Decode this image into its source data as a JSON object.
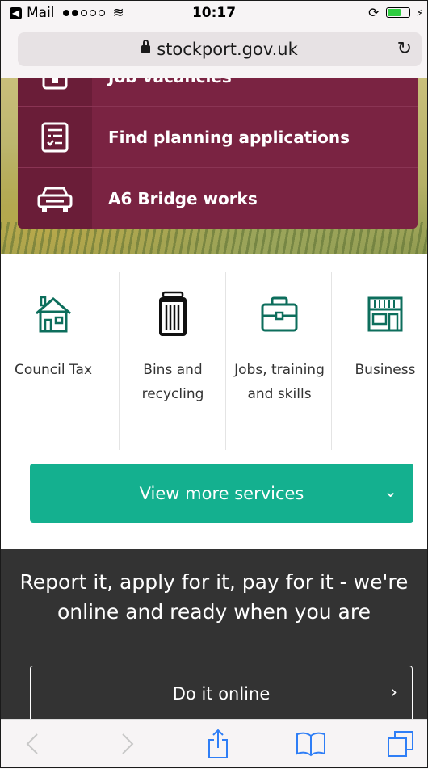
{
  "status_bar": {
    "carrier": "Mail",
    "time": "10:17"
  },
  "browser": {
    "url": "stockport.gov.uk"
  },
  "hero_menu": {
    "partial_item": "Job vacancies",
    "items": [
      {
        "label": "Find planning applications",
        "icon": "planning-list-icon"
      },
      {
        "label": "A6 Bridge works",
        "icon": "car-icon"
      }
    ]
  },
  "services": [
    {
      "label": "Council Tax",
      "icon": "house-icon"
    },
    {
      "label": "Bins and recycling",
      "icon": "bin-icon"
    },
    {
      "label": "Jobs, training and skills",
      "icon": "briefcase-icon"
    },
    {
      "label": "Business",
      "icon": "shopfront-icon"
    }
  ],
  "view_more": {
    "label": "View more services"
  },
  "promo": {
    "text": "Report it, apply for it, pay for it - we're online and ready when you are",
    "button_label": "Do it online"
  },
  "colors": {
    "maroon": "#7a2342",
    "teal": "#14b08f",
    "icon_green": "#0d6e5c",
    "dark_panel": "#333333"
  }
}
